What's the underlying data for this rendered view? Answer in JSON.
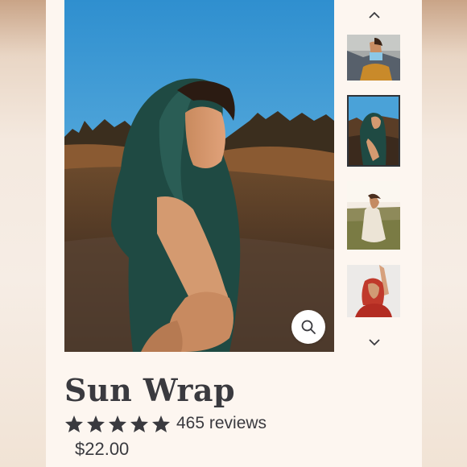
{
  "product": {
    "title": "Sun Wrap",
    "rating": 5,
    "review_count_label": "465 reviews",
    "price": "$22.00"
  },
  "gallery": {
    "main_image": "woman-in-green-hooded-wrap-reaching-hand",
    "zoom_icon": "magnifier-icon",
    "thumbnails": [
      {
        "image": "woman-in-blue-top-and-mustard-pants",
        "selected": false
      },
      {
        "image": "woman-in-green-hooded-wrap",
        "selected": true
      },
      {
        "image": "woman-in-white-dress-sitting-on-grass",
        "selected": false
      },
      {
        "image": "woman-in-red-headscarf-arm-raised",
        "selected": false
      }
    ],
    "up_icon": "chevron-up-icon",
    "down_icon": "chevron-down-icon"
  },
  "colors": {
    "text": "#3a3a3f",
    "page_bg": "#fdf6f0",
    "thumb_border": "#2f3338"
  }
}
